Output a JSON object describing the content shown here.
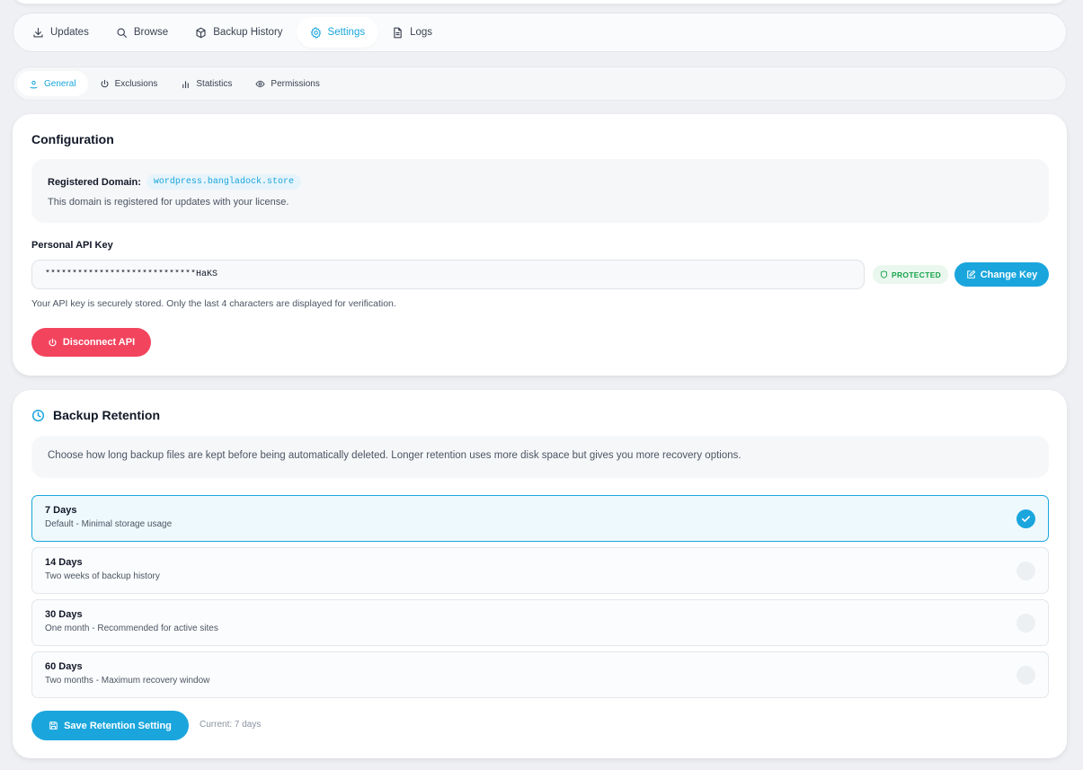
{
  "main_tabs": [
    {
      "label": "Updates",
      "icon": "download-icon"
    },
    {
      "label": "Browse",
      "icon": "search-icon"
    },
    {
      "label": "Backup History",
      "icon": "box-icon"
    },
    {
      "label": "Settings",
      "icon": "gear-icon",
      "active": true
    },
    {
      "label": "Logs",
      "icon": "document-icon"
    }
  ],
  "sub_tabs": [
    {
      "label": "General",
      "icon": "general-icon",
      "active": true
    },
    {
      "label": "Exclusions",
      "icon": "power-icon"
    },
    {
      "label": "Statistics",
      "icon": "bar-chart-icon"
    },
    {
      "label": "Permissions",
      "icon": "eye-icon"
    }
  ],
  "configuration": {
    "title": "Configuration",
    "domain_label": "Registered Domain:",
    "domain_value": "wordpress.bangladock.store",
    "domain_note": "This domain is registered for updates with your license.",
    "api_key_label": "Personal API Key",
    "api_key_value": "****************************HaKS",
    "protected_badge": "PROTECTED",
    "change_key_label": "Change Key",
    "api_note": "Your API key is securely stored. Only the last 4 characters are displayed for verification.",
    "disconnect_label": "Disconnect API"
  },
  "retention": {
    "title": "Backup Retention",
    "description": "Choose how long backup files are kept before being automatically deleted. Longer retention uses more disk space but gives you more recovery options.",
    "options": [
      {
        "title": "7 Days",
        "desc": "Default - Minimal storage usage",
        "selected": true
      },
      {
        "title": "14 Days",
        "desc": "Two weeks of backup history",
        "selected": false
      },
      {
        "title": "30 Days",
        "desc": "One month - Recommended for active sites",
        "selected": false
      },
      {
        "title": "60 Days",
        "desc": "Two months - Maximum recovery window",
        "selected": false
      }
    ],
    "save_label": "Save Retention Setting",
    "current_label": "Current: 7 days"
  },
  "colors": {
    "accent": "#1aa6dd",
    "danger": "#f3445e",
    "success": "#16a34a"
  }
}
